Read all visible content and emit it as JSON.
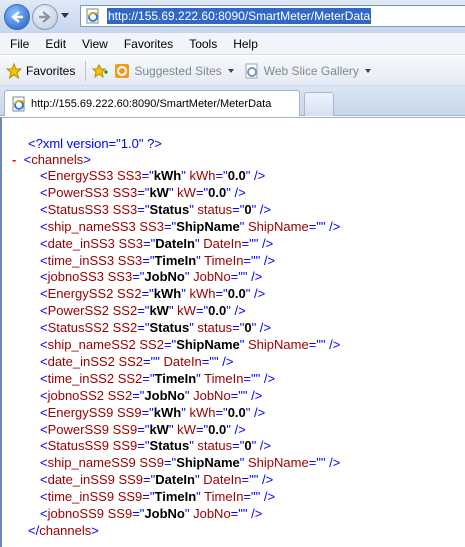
{
  "browser": {
    "url": "http://155.69.222.60:8090/SmartMeter/MeterData",
    "tab_title": "http://155.69.222.60:8090/SmartMeter/MeterData"
  },
  "menu": [
    "File",
    "Edit",
    "View",
    "Favorites",
    "Tools",
    "Help"
  ],
  "favorites_bar": {
    "favorites_label": "Favorites",
    "links": [
      "Suggested Sites",
      "Web Slice Gallery"
    ]
  },
  "xml": {
    "declaration": "<?xml version=\"1.0\" ?>",
    "collapse_symbol": "-",
    "root_open": "channels",
    "root_close": "channels",
    "elements": [
      {
        "name": "EnergySS3",
        "a1": "SS3",
        "v1": "kWh",
        "a2": "kWh",
        "v2": "0.0"
      },
      {
        "name": "PowerSS3",
        "a1": "SS3",
        "v1": "kW",
        "a2": "kW",
        "v2": "0.0"
      },
      {
        "name": "StatusSS3",
        "a1": "SS3",
        "v1": "Status",
        "a2": "status",
        "v2": "0"
      },
      {
        "name": "ship_nameSS3",
        "a1": "SS3",
        "v1": "ShipName",
        "a2": "ShipName",
        "v2": ""
      },
      {
        "name": "date_inSS3",
        "a1": "SS3",
        "v1": "DateIn",
        "a2": "DateIn",
        "v2": ""
      },
      {
        "name": "time_inSS3",
        "a1": "SS3",
        "v1": "TimeIn",
        "a2": "TimeIn",
        "v2": ""
      },
      {
        "name": "jobnoSS3",
        "a1": "SS3",
        "v1": "JobNo",
        "a2": "JobNo",
        "v2": ""
      },
      {
        "name": "EnergySS2",
        "a1": "SS2",
        "v1": "kWh",
        "a2": "kWh",
        "v2": "0.0"
      },
      {
        "name": "PowerSS2",
        "a1": "SS2",
        "v1": "kW",
        "a2": "kW",
        "v2": "0.0"
      },
      {
        "name": "StatusSS2",
        "a1": "SS2",
        "v1": "Status",
        "a2": "status",
        "v2": "0"
      },
      {
        "name": "ship_nameSS2",
        "a1": "SS2",
        "v1": "ShipName",
        "a2": "ShipName",
        "v2": ""
      },
      {
        "name": "date_inSS2",
        "a1": "SS2",
        "v1": "",
        "a2": "DateIn",
        "v2": ""
      },
      {
        "name": "time_inSS2",
        "a1": "SS2",
        "v1": "TimeIn",
        "a2": "TimeIn",
        "v2": ""
      },
      {
        "name": "jobnoSS2",
        "a1": "SS2",
        "v1": "JobNo",
        "a2": "JobNo",
        "v2": ""
      },
      {
        "name": "EnergySS9",
        "a1": "SS9",
        "v1": "kWh",
        "a2": "kWh",
        "v2": "0.0"
      },
      {
        "name": "PowerSS9",
        "a1": "SS9",
        "v1": "kW",
        "a2": "kW",
        "v2": "0.0"
      },
      {
        "name": "StatusSS9",
        "a1": "SS9",
        "v1": "Status",
        "a2": "status",
        "v2": "0"
      },
      {
        "name": "ship_nameSS9",
        "a1": "SS9",
        "v1": "ShipName",
        "a2": "ShipName",
        "v2": ""
      },
      {
        "name": "date_inSS9",
        "a1": "SS9",
        "v1": "DateIn",
        "a2": "DateIn",
        "v2": ""
      },
      {
        "name": "time_inSS9",
        "a1": "SS9",
        "v1": "TimeIn",
        "a2": "TimeIn",
        "v2": ""
      },
      {
        "name": "jobnoSS9",
        "a1": "SS9",
        "v1": "JobNo",
        "a2": "JobNo",
        "v2": ""
      }
    ]
  },
  "colors": {
    "tag": "#990000",
    "bracket": "#0000ff",
    "url_highlight": "#3168c6"
  },
  "icons": {
    "back": "back-arrow-icon",
    "forward": "forward-arrow-icon",
    "page": "ie-page-icon",
    "favorites": "favorites-star-icon",
    "add_favorite": "add-favorite-icon",
    "suggested_sites": "suggested-sites-icon",
    "web_slice": "web-slice-icon"
  }
}
